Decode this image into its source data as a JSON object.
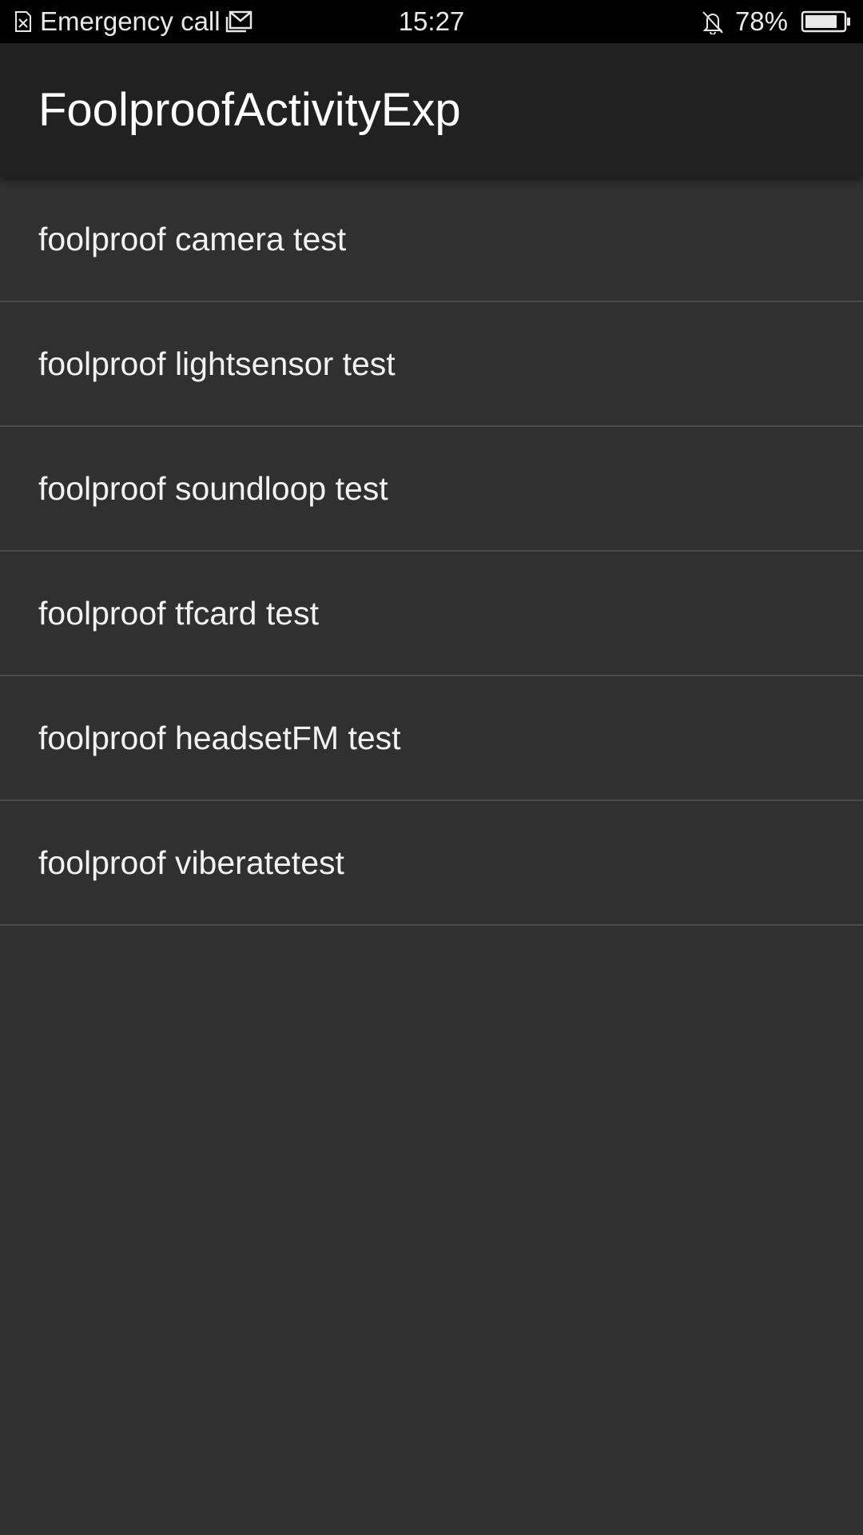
{
  "status_bar": {
    "carrier": "Emergency call",
    "time": "15:27",
    "battery": "78%",
    "icons": [
      "no-sim-icon",
      "mail-icon",
      "bell-off-icon",
      "battery-icon"
    ]
  },
  "app_bar": {
    "title": "FoolproofActivityExp"
  },
  "list": {
    "items": [
      {
        "label": "foolproof camera test"
      },
      {
        "label": "foolproof lightsensor test"
      },
      {
        "label": "foolproof soundloop test"
      },
      {
        "label": "foolproof tfcard test"
      },
      {
        "label": "foolproof headsetFM test"
      },
      {
        "label": "foolproof viberatetest"
      }
    ]
  },
  "colors": {
    "status_bar_bg": "#000000",
    "app_bar_bg": "#212121",
    "background": "#303030",
    "divider": "#4a4a4a",
    "text": "#ffffff"
  }
}
